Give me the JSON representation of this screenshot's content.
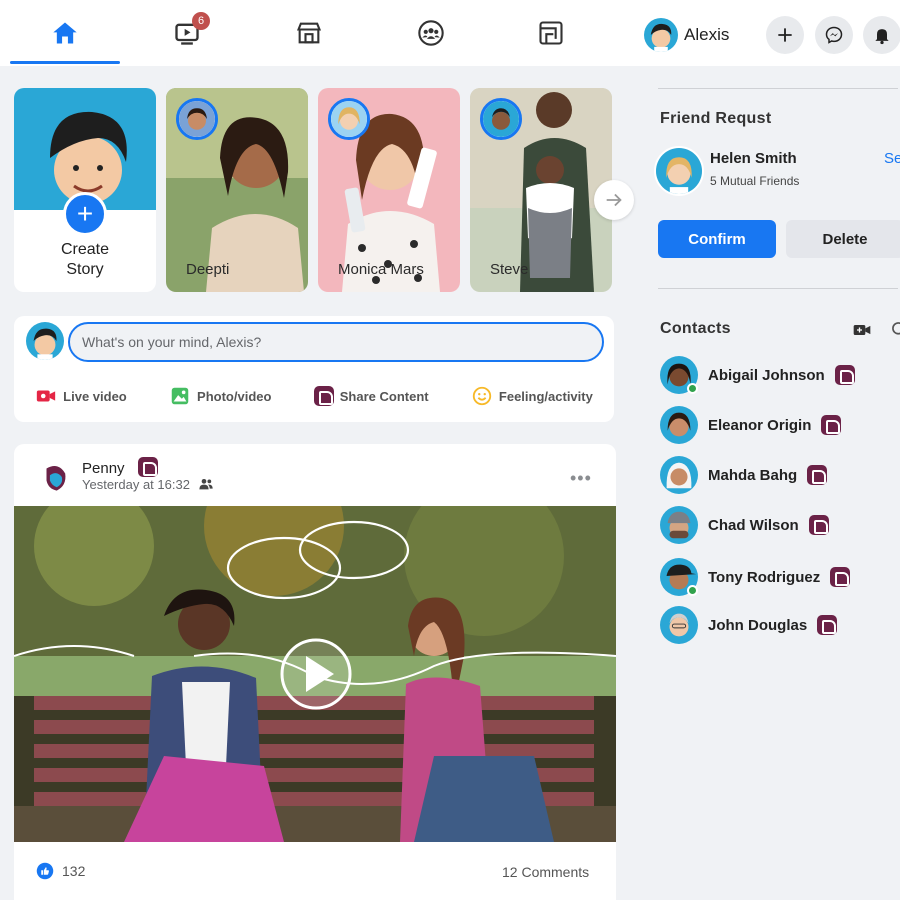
{
  "nav": {
    "tabs": [
      {
        "name": "home",
        "icon": "home-icon",
        "active": true
      },
      {
        "name": "watch",
        "icon": "video-icon",
        "badge": "6"
      },
      {
        "name": "marketplace",
        "icon": "store-icon"
      },
      {
        "name": "groups",
        "icon": "groups-icon"
      },
      {
        "name": "gaming",
        "icon": "gaming-icon"
      }
    ],
    "profile_name": "Alexis",
    "accent": "#1877f2"
  },
  "stories": {
    "create_label": "Create Story",
    "items": [
      {
        "name": "Deepti"
      },
      {
        "name": "Monica Mars"
      },
      {
        "name": "Steve"
      }
    ]
  },
  "composer": {
    "placeholder": "What's on your mind, Alexis?",
    "actions": [
      {
        "label": "Live video",
        "icon": "live-video-icon",
        "color": "#e42645"
      },
      {
        "label": "Photo/video",
        "icon": "photo-icon",
        "color": "#45bd62"
      },
      {
        "label": "Share Content",
        "icon": "share-content-icon",
        "color": "#6b2247"
      },
      {
        "label": "Feeling/activity",
        "icon": "feeling-icon",
        "color": "#f7b928"
      }
    ]
  },
  "post": {
    "author": "Penny",
    "time": "Yesterday at 16:32",
    "likes": "132",
    "comments": "12 Comments"
  },
  "friend_request": {
    "title": "Friend Requst",
    "name": "Helen Smith",
    "mutual": "5 Mutual Friends",
    "see_all": "Se",
    "confirm": "Confirm",
    "delete": "Delete"
  },
  "contacts": {
    "title": "Contacts",
    "items": [
      {
        "name": "Abigail Johnson",
        "online": true
      },
      {
        "name": "Eleanor Origin",
        "online": false
      },
      {
        "name": "Mahda Bahg",
        "online": false
      },
      {
        "name": "Chad Wilson",
        "online": false
      },
      {
        "name": "Tony Rodriguez",
        "online": true
      },
      {
        "name": "John Douglas",
        "online": false
      }
    ]
  }
}
